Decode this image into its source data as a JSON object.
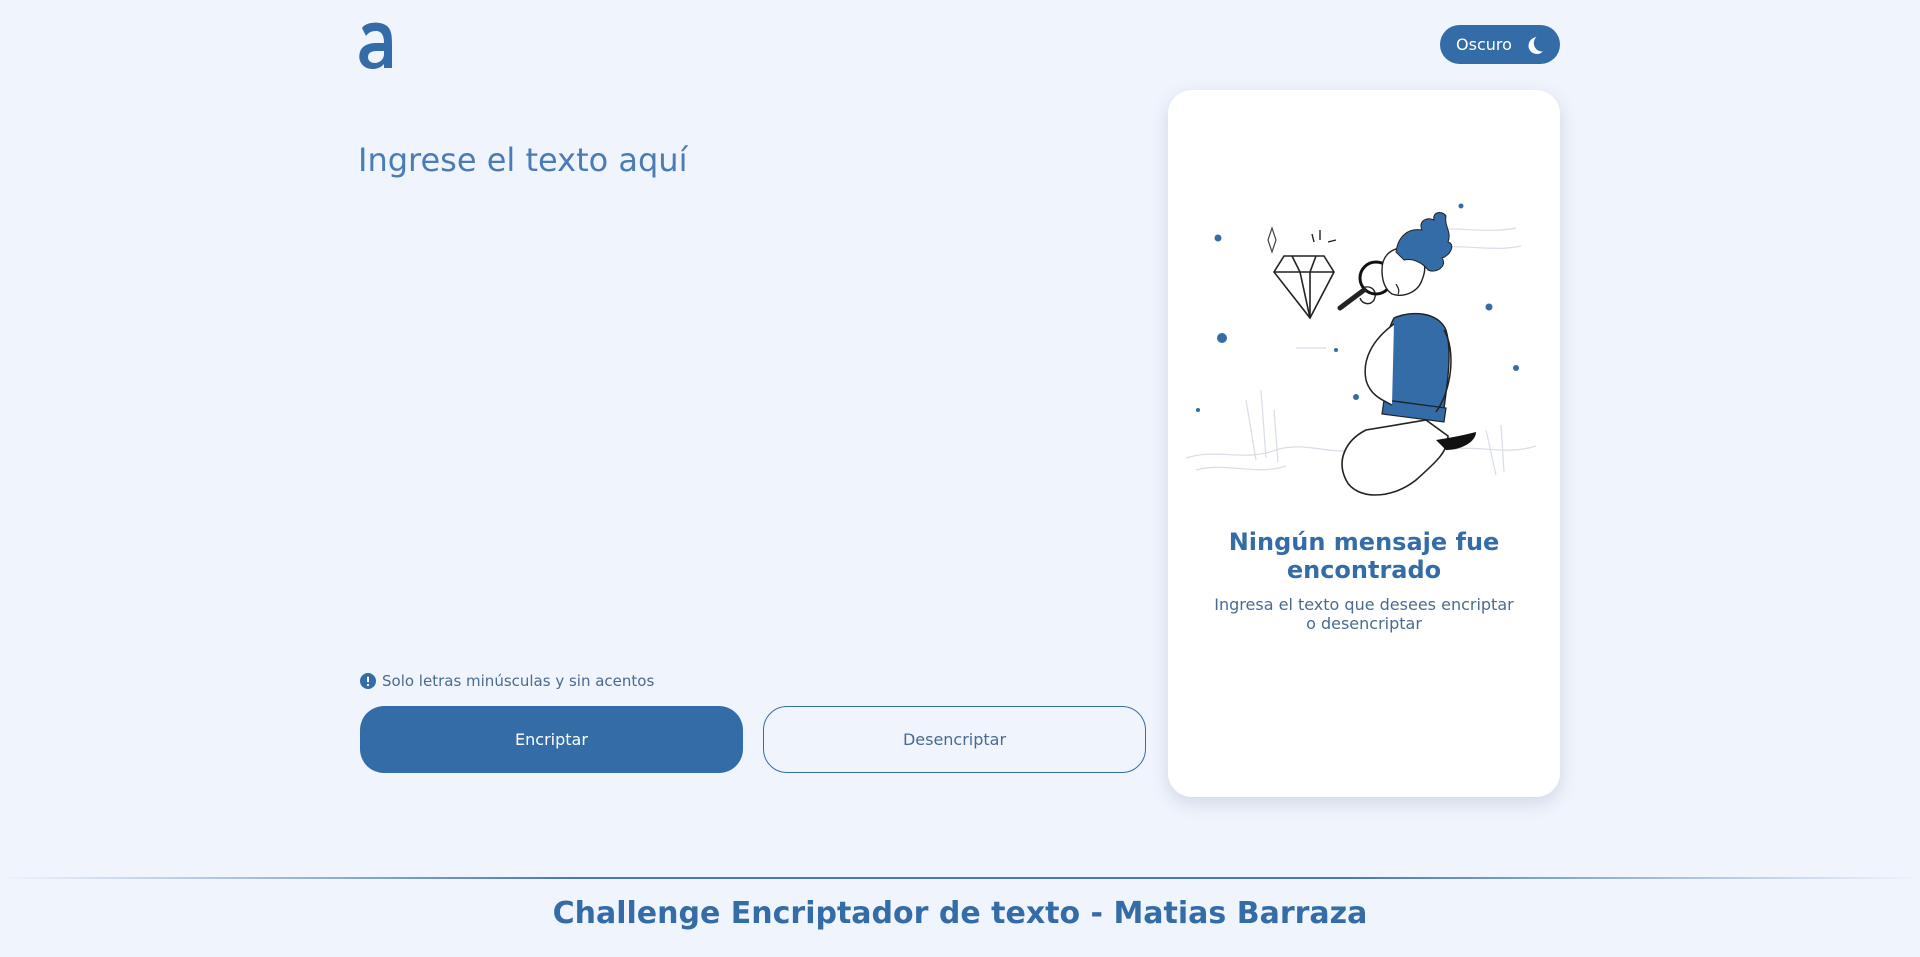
{
  "header": {
    "logo_alt": "a",
    "theme_toggle_label": "Oscuro",
    "theme_toggle_icon": "moon-icon"
  },
  "editor": {
    "placeholder": "Ingrese el texto aquí",
    "value": ""
  },
  "hint": {
    "icon": "info-icon",
    "text": "Solo letras minúsculas y sin acentos"
  },
  "actions": {
    "encrypt_label": "Encriptar",
    "decrypt_label": "Desencriptar"
  },
  "output": {
    "illustration": "person-inspecting-diamond-illustration",
    "title": "Ningún mensaje fue encontrado",
    "subtitle": "Ingresa el texto que desees encriptar o desencriptar"
  },
  "footer": {
    "title": "Challenge Encriptador de texto - Matias Barraza"
  },
  "colors": {
    "background": "#f0f4fc",
    "primary": "#346ca8",
    "muted_text": "#4a6b91",
    "card": "#ffffff"
  }
}
